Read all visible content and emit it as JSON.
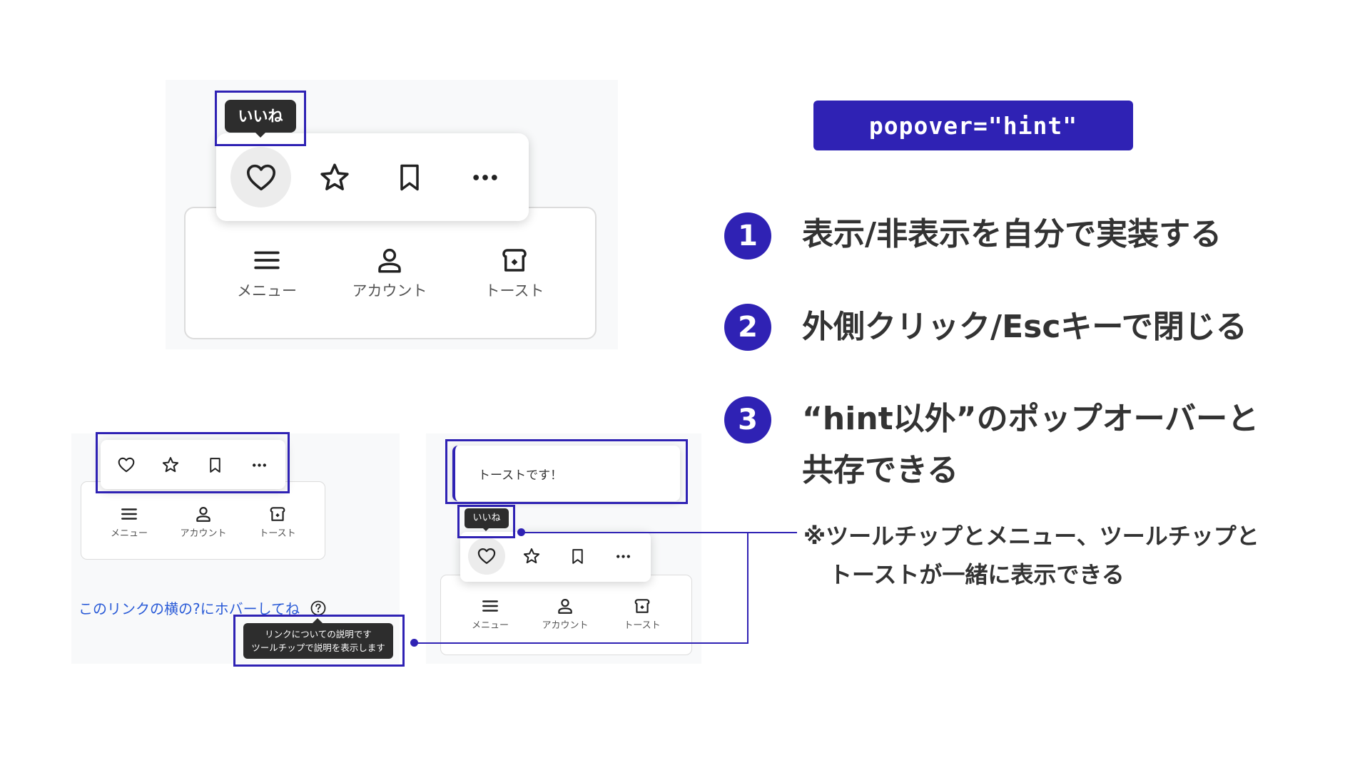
{
  "badge": {
    "label": "popover=\"hint\""
  },
  "points": [
    {
      "num": "1",
      "text": "表示/非表示を自分で実装する"
    },
    {
      "num": "2",
      "text": "外側クリック/Escキーで閉じる"
    },
    {
      "num": "3",
      "line1": "“hint以外”のポップオーバーと",
      "line2": "共存できる"
    }
  ],
  "note": {
    "line1": "※ツールチップとメニュー、ツールチップと",
    "line2": "トーストが一緒に表示できる"
  },
  "nav": {
    "menu": "メニュー",
    "account": "アカウント",
    "toast": "トースト"
  },
  "tooltip": {
    "like": "いいね"
  },
  "toast": {
    "message": "トーストです！"
  },
  "link": {
    "text": "このリンクの横の?にホバーしてね",
    "tooltip_line1": "リンクについての説明です",
    "tooltip_line2": "ツールチップで説明を表示します"
  },
  "colors": {
    "accent": "#2f22b4",
    "tooltip_bg": "#2d2d2d",
    "link": "#2a5bd7",
    "panel_bg": "#f8f9fa"
  },
  "icons": [
    "heart-icon",
    "star-icon",
    "bookmark-icon",
    "more-icon",
    "menu-icon",
    "account-icon",
    "toast-icon",
    "help-icon"
  ]
}
